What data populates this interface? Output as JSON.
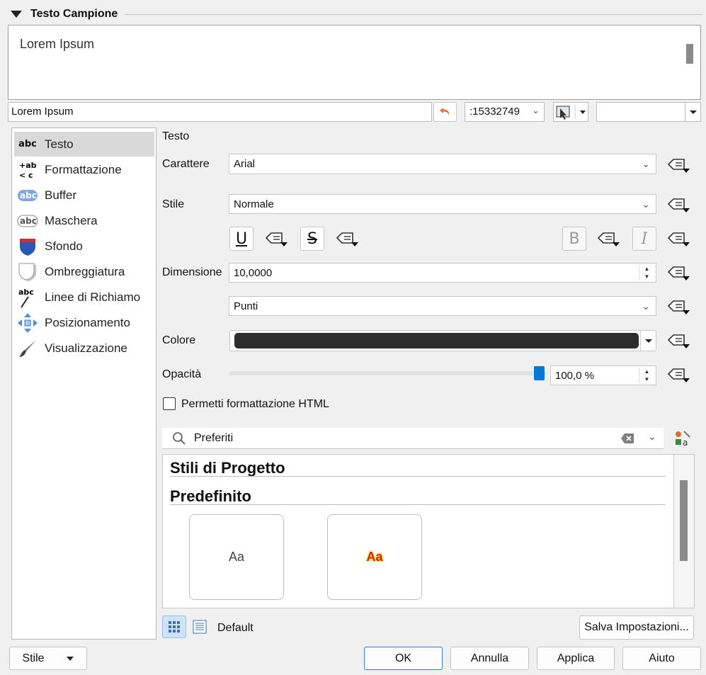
{
  "section": {
    "title": "Testo Campione"
  },
  "preview": {
    "text": "Lorem Ipsum"
  },
  "sample_input": {
    "value": "Lorem Ipsum"
  },
  "scale": {
    "value": ":15332749"
  },
  "sidebar": {
    "items": [
      {
        "label": "Testo",
        "icon": "text-abc-icon",
        "selected": true
      },
      {
        "label": "Formattazione",
        "icon": "formatting-icon"
      },
      {
        "label": "Buffer",
        "icon": "buffer-icon"
      },
      {
        "label": "Maschera",
        "icon": "mask-icon"
      },
      {
        "label": "Sfondo",
        "icon": "background-shield-icon"
      },
      {
        "label": "Ombreggiatura",
        "icon": "shadow-icon"
      },
      {
        "label": "Linee di Richiamo",
        "icon": "callout-icon"
      },
      {
        "label": "Posizionamento",
        "icon": "placement-icon"
      },
      {
        "label": "Visualizzazione",
        "icon": "rendering-brush-icon"
      }
    ]
  },
  "text_panel": {
    "heading": "Testo",
    "font_label": "Carattere",
    "font_value": "Arial",
    "style_label": "Stile",
    "style_value": "Normale",
    "underline_glyph": "U",
    "strike_glyph": "S",
    "bold_glyph": "B",
    "italic_glyph": "I",
    "size_label": "Dimensione",
    "size_value": "10,0000",
    "unit_value": "Punti",
    "color_label": "Colore",
    "color_value": "#2d2d2d",
    "opacity_label": "Opacità",
    "opacity_value": "100,0 %",
    "opacity_fraction": 1.0,
    "html_label": "Permetti formattazione HTML"
  },
  "styles": {
    "search_value": "Preferiti",
    "groups": [
      {
        "title": "Stili di Progetto"
      },
      {
        "title": "Predefinito"
      }
    ],
    "tiles": [
      {
        "sample": "Aa",
        "kind": "plain"
      },
      {
        "sample": "Aa",
        "kind": "buffered"
      }
    ],
    "view_label": "Default",
    "save_label": "Salva Impostazioni..."
  },
  "footer": {
    "style_label": "Stile",
    "ok_label": "OK",
    "cancel_label": "Annulla",
    "apply_label": "Applica",
    "help_label": "Aiuto"
  },
  "colors": {
    "accent": "#0078d7",
    "undo": "#e8732a"
  }
}
